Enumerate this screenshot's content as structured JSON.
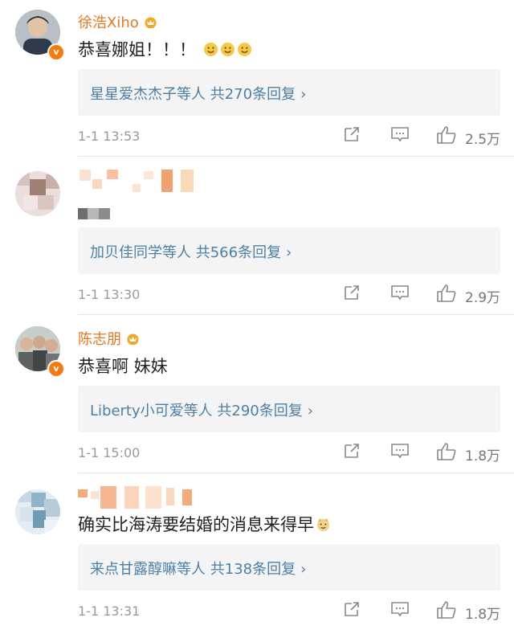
{
  "comments": [
    {
      "username": "徐浩Xiho",
      "verified": true,
      "content": "恭喜娜姐！！！",
      "emojis": [
        "smile-emoji",
        "smile-emoji",
        "smile-emoji"
      ],
      "reply_summary": "星星爱杰杰子等人 共270条回复",
      "time": "1-1 13:53",
      "likes": "2.5万"
    },
    {
      "username": "",
      "verified": false,
      "content": "",
      "reply_summary": "加贝佳同学等人 共566条回复",
      "time": "1-1 13:30",
      "likes": "2.9万"
    },
    {
      "username": "陈志朋",
      "verified": true,
      "content": "恭喜啊 妹妹",
      "reply_summary": "Liberty小可爱等人 共290条回复",
      "time": "1-1 15:00",
      "likes": "1.8万"
    },
    {
      "username": "",
      "verified": false,
      "content": "确实比海涛要结婚的消息来得早",
      "emojis": [
        "doge-emoji"
      ],
      "reply_summary": "来点甘露醇嘛等人 共138条回复",
      "time": "1-1 13:31",
      "likes": "1.8万"
    }
  ],
  "colors": {
    "username": "#e87722",
    "link": "#4c7fa8",
    "meta": "#9a9a9a",
    "reply_bg": "#f4f4f4",
    "verified_badge": "#f77b0c"
  },
  "icons": {
    "reply_chevron": "›",
    "forward": "share-icon",
    "comment": "comment-icon",
    "like": "thumbs-up-icon"
  }
}
